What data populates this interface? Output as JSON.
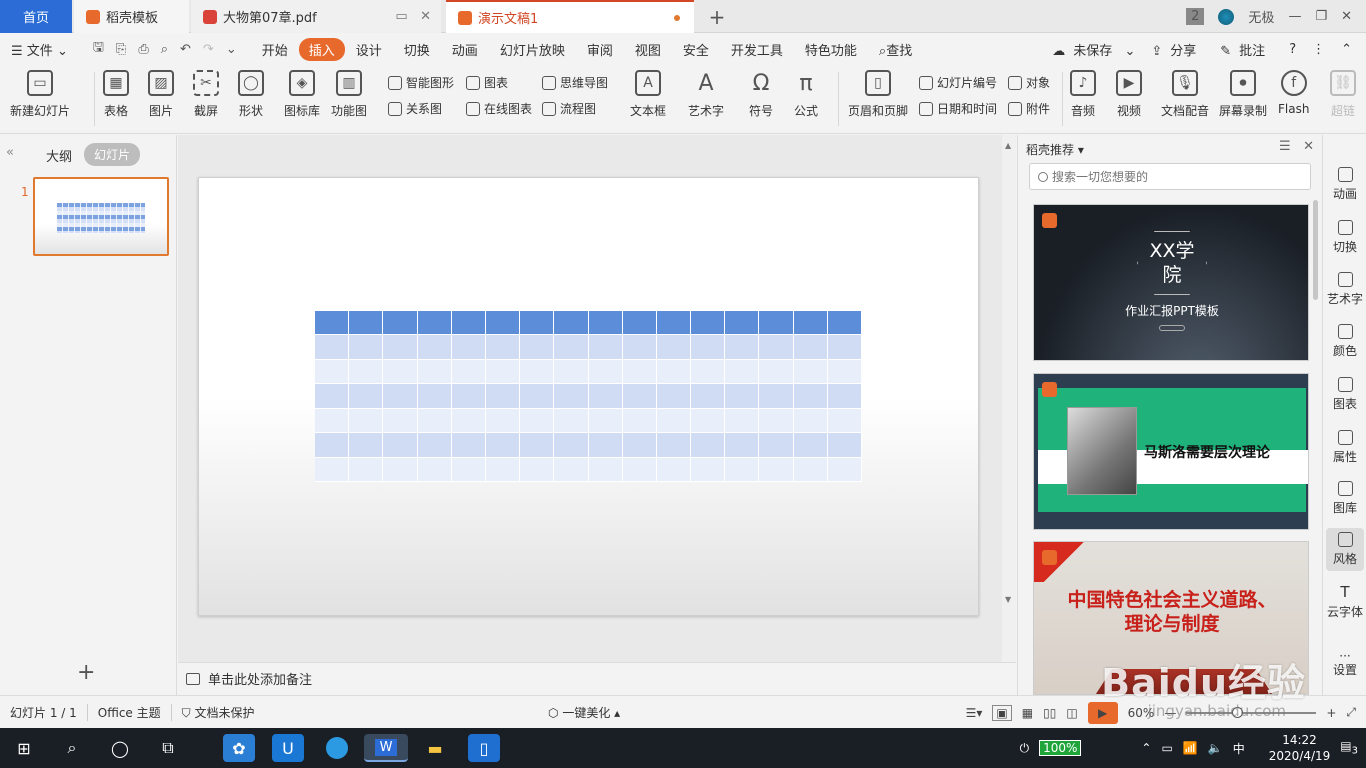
{
  "tabs": [
    {
      "label": "首页"
    },
    {
      "label": "稻壳模板"
    },
    {
      "label": "大物第07章.pdf"
    },
    {
      "label": "演示文稿1"
    }
  ],
  "window": {
    "badge": "2",
    "user": "无极",
    "minimize": "—",
    "restore": "❐",
    "close": "✕"
  },
  "menu": {
    "file": "文件",
    "items": [
      "开始",
      "插入",
      "设计",
      "切换",
      "动画",
      "幻灯片放映",
      "审阅",
      "视图",
      "安全",
      "开发工具",
      "特色功能"
    ],
    "active": "插入",
    "search": "查找",
    "unsaved": "未保存",
    "share": "分享",
    "comment": "批注"
  },
  "ribbon": {
    "new_slide": "新建幻灯片",
    "table": "表格",
    "picture": "图片",
    "screenshot": "截屏",
    "shape": "形状",
    "icon_lib": "图标库",
    "func_chart": "功能图",
    "smart_shape": "智能图形",
    "chart": "图表",
    "relation": "关系图",
    "online_chart": "在线图表",
    "mindmap": "思维导图",
    "flowchart": "流程图",
    "textbox": "文本框",
    "wordart": "艺术字",
    "symbol": "符号",
    "formula": "公式",
    "header_footer": "页眉和页脚",
    "slide_number": "幻灯片编号",
    "datetime": "日期和时间",
    "object": "对象",
    "attachment": "附件",
    "audio": "音频",
    "video": "视频",
    "voiceover": "文档配音",
    "screen_record": "屏幕录制",
    "flash": "Flash",
    "superlink": "超链"
  },
  "left_panel": {
    "outline": "大纲",
    "slides": "幻灯片",
    "slide_number": "1"
  },
  "notes": {
    "placeholder": "单击此处添加备注"
  },
  "right_panel": {
    "title": "稻壳推荐",
    "search_placeholder": "搜索一切您想要的",
    "cards": [
      {
        "title": "XX学院",
        "subtitle": "作业汇报PPT模板"
      },
      {
        "title": "马斯洛需要层次理论"
      },
      {
        "title": "中国特色社会主义道路、理论与制度"
      }
    ]
  },
  "sidebar": [
    "动画",
    "切换",
    "艺术字",
    "颜色",
    "图表",
    "属性",
    "图库",
    "风格",
    "云字体",
    "设置"
  ],
  "status": {
    "slide_count": "幻灯片 1 / 1",
    "theme": "Office 主题",
    "protect": "文档未保护",
    "beautify": "一键美化",
    "zoom": "60%",
    "zoom_level": 0.3
  },
  "watermark": {
    "logo": "Baidu经验",
    "url": "jingyan.baidu.com"
  },
  "taskbar": {
    "battery": "100%",
    "time": "14:22",
    "date": "2020/4/19",
    "notifications": "3"
  },
  "table": {
    "rows": 7,
    "cols": 16,
    "header_color": "#5b8dd9",
    "band1": "#d0dcf4",
    "band2": "#e8eefa"
  }
}
